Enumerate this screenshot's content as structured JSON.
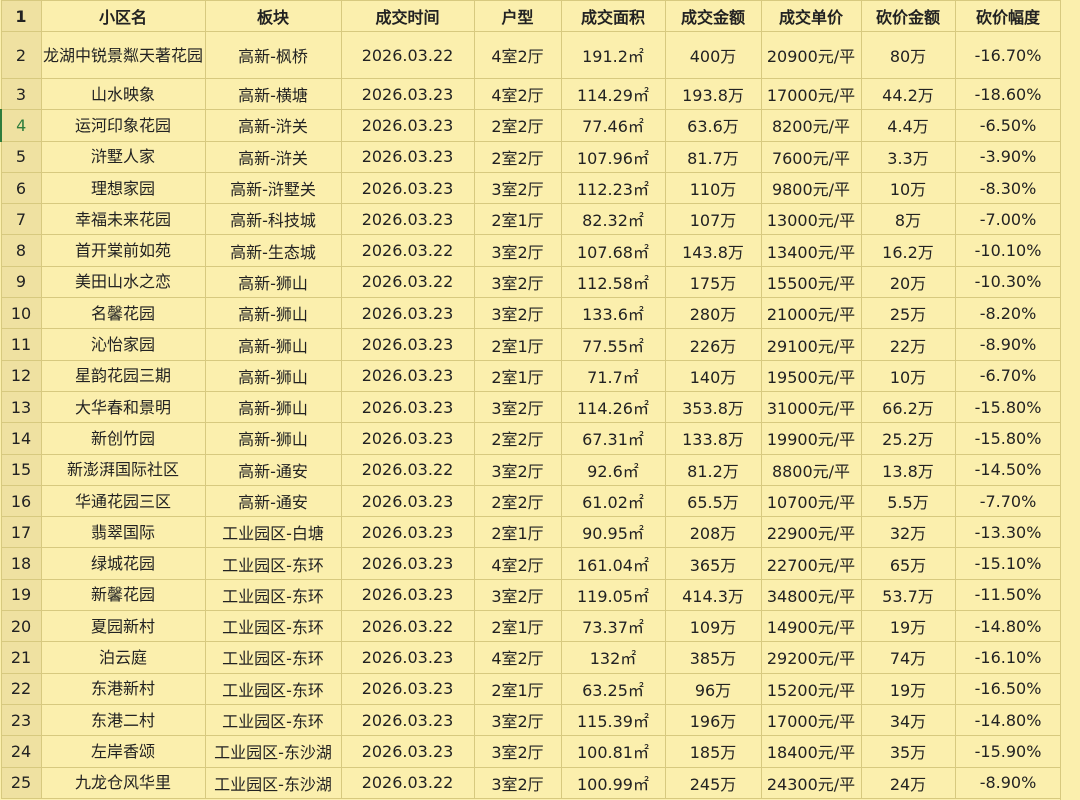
{
  "headers": {
    "row_number": "1",
    "name": "小区名",
    "area": "板块",
    "date": "成交时间",
    "type": "户型",
    "sqm": "成交面积",
    "amount": "成交金额",
    "unit": "成交单价",
    "cut": "砍价金额",
    "pct": "砍价幅度"
  },
  "colors": {
    "background": "#fbefad",
    "sqm": "#3fb21b",
    "amount": "#e8321f",
    "unit": "#29b19a"
  },
  "rows": [
    {
      "rn": "2",
      "name": "龙湖中锐景粼天著花园",
      "area": "高新-枫桥",
      "date": "2026.03.22",
      "type": "4室2厅",
      "sqm": "191.2㎡",
      "amount": "400万",
      "unit": "20900元/平",
      "cut": "80万",
      "pct": "-16.70%"
    },
    {
      "rn": "3",
      "name": "山水映象",
      "area": "高新-横塘",
      "date": "2026.03.23",
      "type": "4室2厅",
      "sqm": "114.29㎡",
      "amount": "193.8万",
      "unit": "17000元/平",
      "cut": "44.2万",
      "pct": "-18.60%"
    },
    {
      "rn": "4",
      "name": "运河印象花园",
      "area": "高新-浒关",
      "date": "2026.03.23",
      "type": "2室2厅",
      "sqm": "77.46㎡",
      "amount": "63.6万",
      "unit": "8200元/平",
      "cut": "4.4万",
      "pct": "-6.50%"
    },
    {
      "rn": "5",
      "name": "浒墅人家",
      "area": "高新-浒关",
      "date": "2026.03.23",
      "type": "2室2厅",
      "sqm": "107.96㎡",
      "amount": "81.7万",
      "unit": "7600元/平",
      "cut": "3.3万",
      "pct": "-3.90%"
    },
    {
      "rn": "6",
      "name": "理想家园",
      "area": "高新-浒墅关",
      "date": "2026.03.23",
      "type": "3室2厅",
      "sqm": "112.23㎡",
      "amount": "110万",
      "unit": "9800元/平",
      "cut": "10万",
      "pct": "-8.30%"
    },
    {
      "rn": "7",
      "name": "幸福未来花园",
      "area": "高新-科技城",
      "date": "2026.03.23",
      "type": "2室1厅",
      "sqm": "82.32㎡",
      "amount": "107万",
      "unit": "13000元/平",
      "cut": "8万",
      "pct": "-7.00%"
    },
    {
      "rn": "8",
      "name": "首开棠前如苑",
      "area": "高新-生态城",
      "date": "2026.03.22",
      "type": "3室2厅",
      "sqm": "107.68㎡",
      "amount": "143.8万",
      "unit": "13400元/平",
      "cut": "16.2万",
      "pct": "-10.10%"
    },
    {
      "rn": "9",
      "name": "美田山水之恋",
      "area": "高新-狮山",
      "date": "2026.03.22",
      "type": "3室2厅",
      "sqm": "112.58㎡",
      "amount": "175万",
      "unit": "15500元/平",
      "cut": "20万",
      "pct": "-10.30%"
    },
    {
      "rn": "10",
      "name": "名馨花园",
      "area": "高新-狮山",
      "date": "2026.03.23",
      "type": "3室2厅",
      "sqm": "133.6㎡",
      "amount": "280万",
      "unit": "21000元/平",
      "cut": "25万",
      "pct": "-8.20%"
    },
    {
      "rn": "11",
      "name": "沁怡家园",
      "area": "高新-狮山",
      "date": "2026.03.23",
      "type": "2室1厅",
      "sqm": "77.55㎡",
      "amount": "226万",
      "unit": "29100元/平",
      "cut": "22万",
      "pct": "-8.90%"
    },
    {
      "rn": "12",
      "name": "星韵花园三期",
      "area": "高新-狮山",
      "date": "2026.03.23",
      "type": "2室1厅",
      "sqm": "71.7㎡",
      "amount": "140万",
      "unit": "19500元/平",
      "cut": "10万",
      "pct": "-6.70%"
    },
    {
      "rn": "13",
      "name": "大华春和景明",
      "area": "高新-狮山",
      "date": "2026.03.23",
      "type": "3室2厅",
      "sqm": "114.26㎡",
      "amount": "353.8万",
      "unit": "31000元/平",
      "cut": "66.2万",
      "pct": "-15.80%"
    },
    {
      "rn": "14",
      "name": "新创竹园",
      "area": "高新-狮山",
      "date": "2026.03.23",
      "type": "2室2厅",
      "sqm": "67.31㎡",
      "amount": "133.8万",
      "unit": "19900元/平",
      "cut": "25.2万",
      "pct": "-15.80%"
    },
    {
      "rn": "15",
      "name": "新澎湃国际社区",
      "area": "高新-通安",
      "date": "2026.03.22",
      "type": "3室2厅",
      "sqm": "92.6㎡",
      "amount": "81.2万",
      "unit": "8800元/平",
      "cut": "13.8万",
      "pct": "-14.50%"
    },
    {
      "rn": "16",
      "name": "华通花园三区",
      "area": "高新-通安",
      "date": "2026.03.23",
      "type": "2室2厅",
      "sqm": "61.02㎡",
      "amount": "65.5万",
      "unit": "10700元/平",
      "cut": "5.5万",
      "pct": "-7.70%"
    },
    {
      "rn": "17",
      "name": "翡翠国际",
      "area": "工业园区-白塘",
      "date": "2026.03.23",
      "type": "2室1厅",
      "sqm": "90.95㎡",
      "amount": "208万",
      "unit": "22900元/平",
      "cut": "32万",
      "pct": "-13.30%"
    },
    {
      "rn": "18",
      "name": "绿城花园",
      "area": "工业园区-东环",
      "date": "2026.03.23",
      "type": "4室2厅",
      "sqm": "161.04㎡",
      "amount": "365万",
      "unit": "22700元/平",
      "cut": "65万",
      "pct": "-15.10%"
    },
    {
      "rn": "19",
      "name": "新馨花园",
      "area": "工业园区-东环",
      "date": "2026.03.23",
      "type": "3室2厅",
      "sqm": "119.05㎡",
      "amount": "414.3万",
      "unit": "34800元/平",
      "cut": "53.7万",
      "pct": "-11.50%"
    },
    {
      "rn": "20",
      "name": "夏园新村",
      "area": "工业园区-东环",
      "date": "2026.03.22",
      "type": "2室1厅",
      "sqm": "73.37㎡",
      "amount": "109万",
      "unit": "14900元/平",
      "cut": "19万",
      "pct": "-14.80%"
    },
    {
      "rn": "21",
      "name": "泊云庭",
      "area": "工业园区-东环",
      "date": "2026.03.23",
      "type": "4室2厅",
      "sqm": "132㎡",
      "amount": "385万",
      "unit": "29200元/平",
      "cut": "74万",
      "pct": "-16.10%"
    },
    {
      "rn": "22",
      "name": "东港新村",
      "area": "工业园区-东环",
      "date": "2026.03.23",
      "type": "2室1厅",
      "sqm": "63.25㎡",
      "amount": "96万",
      "unit": "15200元/平",
      "cut": "19万",
      "pct": "-16.50%"
    },
    {
      "rn": "23",
      "name": "东港二村",
      "area": "工业园区-东环",
      "date": "2026.03.23",
      "type": "3室2厅",
      "sqm": "115.39㎡",
      "amount": "196万",
      "unit": "17000元/平",
      "cut": "34万",
      "pct": "-14.80%"
    },
    {
      "rn": "24",
      "name": "左岸香颂",
      "area": "工业园区-东沙湖",
      "date": "2026.03.23",
      "type": "3室2厅",
      "sqm": "100.81㎡",
      "amount": "185万",
      "unit": "18400元/平",
      "cut": "35万",
      "pct": "-15.90%"
    },
    {
      "rn": "25",
      "name": "九龙仓风华里",
      "area": "工业园区-东沙湖",
      "date": "2026.03.22",
      "type": "3室2厅",
      "sqm": "100.99㎡",
      "amount": "245万",
      "unit": "24300元/平",
      "cut": "24万",
      "pct": "-8.90%"
    }
  ]
}
